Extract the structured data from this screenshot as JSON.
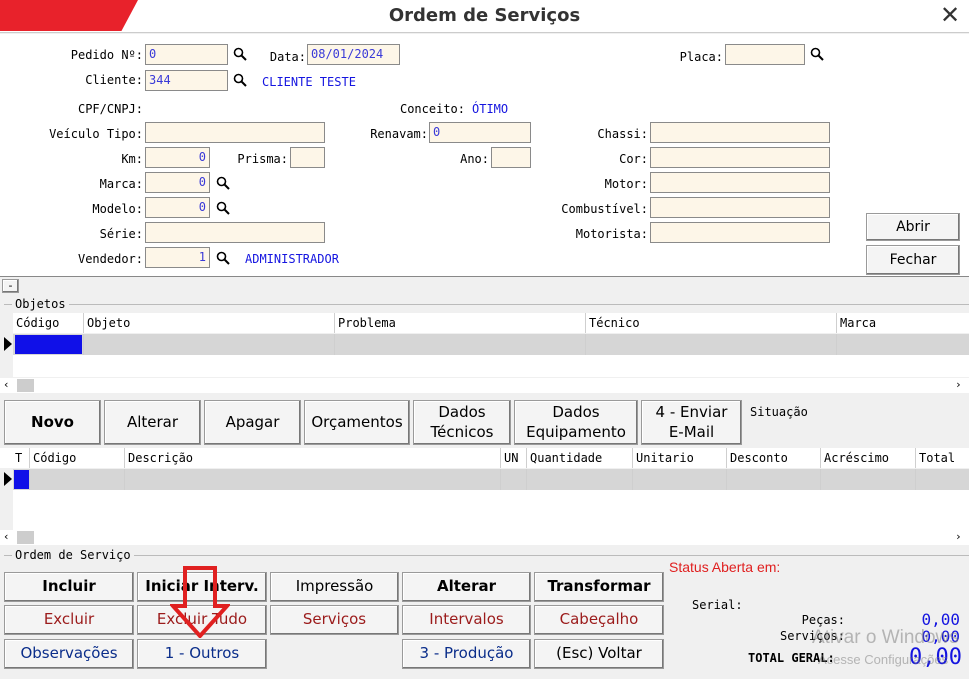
{
  "window": {
    "title": "Ordem de Serviços"
  },
  "header": {
    "pedido_label": "Pedido Nº:",
    "pedido_value": "0",
    "data_label": "Data:",
    "data_value": "08/01/2024",
    "placa_label": "Placa:",
    "placa_value": "",
    "cliente_label": "Cliente:",
    "cliente_value": "344",
    "cliente_name": "CLIENTE TESTE",
    "cpf_label": "CPF/CNPJ:",
    "conceito_label": "Conceito:",
    "conceito_value": "ÓTIMO",
    "veiculo_label": "Veículo Tipo:",
    "veiculo_value": "",
    "renavam_label": "Renavam:",
    "renavam_value": "0",
    "chassi_label": "Chassi:",
    "chassi_value": "",
    "km_label": "Km:",
    "km_value": "0",
    "prisma_label": "Prisma:",
    "prisma_value": "",
    "ano_label": "Ano:",
    "ano_value": "",
    "cor_label": "Cor:",
    "cor_value": "",
    "marca_label": "Marca:",
    "marca_value": "0",
    "motor_label": "Motor:",
    "motor_value": "",
    "modelo_label": "Modelo:",
    "modelo_value": "0",
    "combustivel_label": "Combustível:",
    "combustivel_value": "",
    "serie_label": "Série:",
    "serie_value": "",
    "motorista_label": "Motorista:",
    "motorista_value": "",
    "vendedor_label": "Vendedor:",
    "vendedor_value": "1",
    "vendedor_name": "ADMINISTRADOR",
    "abrir_label": "Abrir",
    "fechar_label": "Fechar",
    "collapse_label": "-"
  },
  "objetos": {
    "group_label": "Objetos",
    "columns": [
      "Código",
      "Objeto",
      "Problema",
      "Técnico",
      "Marca"
    ]
  },
  "toolbar": {
    "novo": "Novo",
    "alterar": "Alterar",
    "apagar": "Apagar",
    "orcamentos": "Orçamentos",
    "dados_tecnicos_1": "Dados",
    "dados_tecnicos_2": "Técnicos",
    "dados_equip_1": "Dados",
    "dados_equip_2": "Equipamento",
    "enviar_1": "4 - Enviar",
    "enviar_2": "E-Mail",
    "situacao": "Situação"
  },
  "itens": {
    "columns": [
      "T",
      "Código",
      "Descrição",
      "UN",
      "Quantidade",
      "Unitario",
      "Desconto",
      "Acréscimo",
      "Total"
    ]
  },
  "ordem": {
    "group_label": "Ordem de Serviço",
    "incluir": "Incluir",
    "iniciar": "Iniciar Interv.",
    "impressao": "Impressão",
    "alterar": "Alterar",
    "transformar": "Transformar",
    "excluir": "Excluir",
    "excluir_tudo": "Excluir Tudo",
    "servicos": "Serviços",
    "intervalos": "Intervalos",
    "cabecalho": "Cabeçalho",
    "observacoes": "Observações",
    "outros": "1 - Outros",
    "producao": "3 - Produção",
    "voltar": "(Esc) Voltar"
  },
  "status": {
    "status_text": "Status Aberta em:",
    "serial_label": "Serial:",
    "pecas_label": "Peças:",
    "pecas_value": "0,00",
    "servicos_label": "Serviços:",
    "servicos_value": "0,00",
    "total_label": "TOTAL GERAL:",
    "total_value": "0,00",
    "watermark_1": "Ativar o Windows",
    "watermark_2": "Acesse Configurações"
  },
  "colors": {
    "accent_red": "#e8222b",
    "field_bg": "#fdf6e8",
    "value_blue": "#1515e0",
    "annotation_red": "#e02020"
  }
}
